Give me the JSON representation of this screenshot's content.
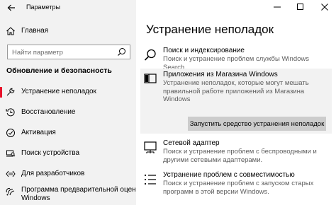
{
  "window": {
    "title": "Параметры",
    "controls": {
      "minimize": "—",
      "maximize": "☐",
      "close": "✕"
    }
  },
  "sidebar": {
    "home_label": "Главная",
    "search": {
      "placeholder": "Найти параметр"
    },
    "section_title": "Обновление и безопасность",
    "items": [
      {
        "label": "Устранение неполадок",
        "icon": "wrench-icon",
        "active": true
      },
      {
        "label": "Восстановление",
        "icon": "recovery-icon",
        "active": false
      },
      {
        "label": "Активация",
        "icon": "activation-check-icon",
        "active": false
      },
      {
        "label": "Поиск устройства",
        "icon": "find-device-icon",
        "active": false
      },
      {
        "label": "Для разработчиков",
        "icon": "developer-icon",
        "active": false
      },
      {
        "label": "Программа предварительной оценки Windows",
        "line1": "Программа предварительной оценки",
        "line2": "Windows",
        "icon": "insider-icon",
        "active": false
      }
    ]
  },
  "main": {
    "title": "Устранение неполадок",
    "troubleshooters": [
      {
        "name": "Поиск и индексирование",
        "desc": "Поиск и устранение проблем службы Windows Search.",
        "icon": "search-icon"
      },
      {
        "name": "Приложения из Магазина Windows",
        "desc": "Устранение неполадок, которые могут мешать правильной работе приложений из Магазина Windows",
        "icon": "store-app-icon",
        "expanded": true,
        "button": "Запустить средство устранения неполадок"
      },
      {
        "name": "Сетевой адаптер",
        "desc": "Поиск и устранение проблем с беспроводными и другими сетевыми адаптерами.",
        "icon": "network-adapter-icon"
      },
      {
        "name": "Устранение проблем с совместимостью",
        "desc": "Поиск и устранение проблем с запуском старых программ в этой версии Windows.",
        "icon": "compatibility-icon"
      }
    ]
  },
  "colors": {
    "accent": "#e8102a",
    "sidebar_bg": "#f2f2f2",
    "expanded_bg": "#f2f2f2",
    "button_bg": "#cccccc",
    "desc_text": "#5d5d5d"
  }
}
